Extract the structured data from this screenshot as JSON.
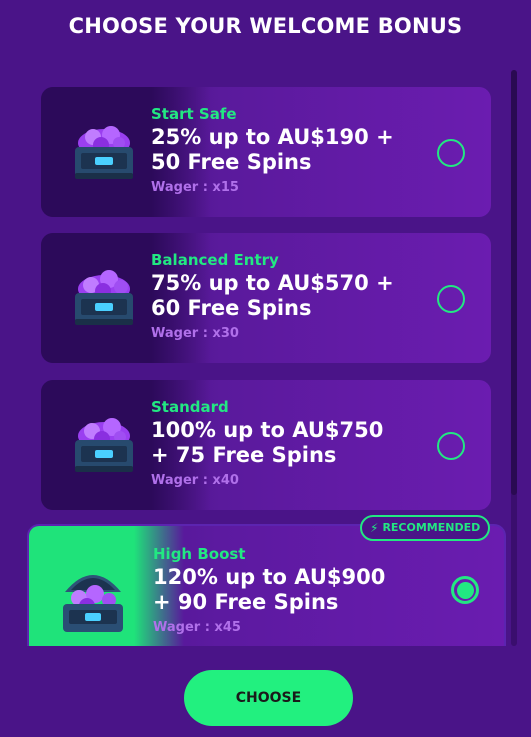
{
  "header": {
    "title": "CHOOSE YOUR WELCOME BONUS"
  },
  "bonuses": [
    {
      "name": "Start Safe",
      "offer_line1": "25% up to AU$190 +",
      "offer_line2": "50 Free Spins",
      "wager": "Wager : x15",
      "selected": false
    },
    {
      "name": "Balanced Entry",
      "offer_line1": "75% up to AU$570 +",
      "offer_line2": "60 Free Spins",
      "wager": "Wager : x30",
      "selected": false
    },
    {
      "name": "Standard",
      "offer_line1": "100% up to AU$750",
      "offer_line2": "+ 75 Free Spins",
      "wager": "Wager : x40",
      "selected": false
    },
    {
      "name": "High Boost",
      "offer_line1": "120% up to AU$900",
      "offer_line2": "+ 90 Free Spins",
      "wager": "Wager : x45",
      "selected": true,
      "badge": "RECOMMENDED"
    }
  ],
  "actions": {
    "choose_label": "CHOOSE"
  },
  "colors": {
    "background": "#4a1488",
    "accent": "#22e882",
    "wager": "#b070ea"
  },
  "icons": {
    "badge": "lightning-icon",
    "card_art": "gem-chest-icon"
  }
}
